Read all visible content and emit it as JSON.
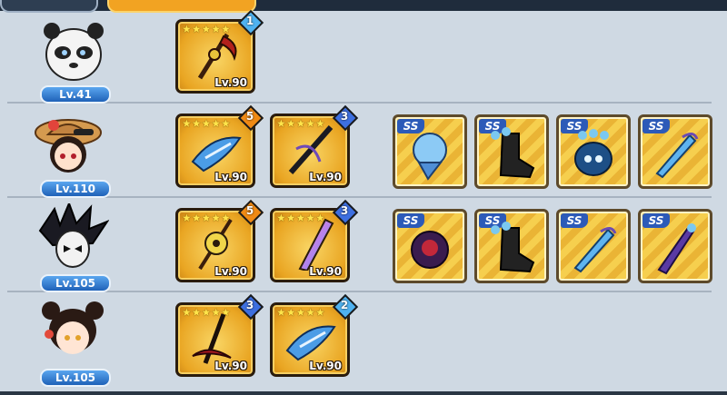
{
  "colors": {
    "accent": "#f2a322",
    "background": "#cfd9e3",
    "badge": "#2f7ad4"
  },
  "tabs": [
    {
      "label": ""
    },
    {
      "label": ""
    }
  ],
  "heroes": [
    {
      "name_icon": "panda-hero-icon",
      "level": "Lv.41",
      "weapons": [
        {
          "icon": "fire-scythe-icon",
          "stars": 5,
          "rank": "1",
          "level": "Lv.90"
        }
      ],
      "equipment": []
    },
    {
      "name_icon": "straw-hat-girl-hero-icon",
      "level": "Lv.110",
      "weapons": [
        {
          "icon": "shark-blade-icon",
          "stars": 5,
          "rank": "5",
          "level": "Lv.90"
        },
        {
          "icon": "dark-katana-icon",
          "stars": 5,
          "rank": "3",
          "level": "Lv.90"
        }
      ],
      "equipment": [
        {
          "tag": "SS",
          "icon": "blue-gauntlet-icon"
        },
        {
          "tag": "SS",
          "icon": "dark-boot-icon"
        },
        {
          "tag": "SS",
          "icon": "blue-spirit-helmet-icon"
        },
        {
          "tag": "SS",
          "icon": "crystal-amulet-icon"
        }
      ]
    },
    {
      "name_icon": "spiky-hair-masked-hero-icon",
      "level": "Lv.105",
      "weapons": [
        {
          "icon": "tomoe-staff-icon",
          "stars": 5,
          "rank": "5",
          "level": "Lv.90"
        },
        {
          "icon": "lightning-blade-icon",
          "stars": 5,
          "rank": "3",
          "level": "Lv.90"
        }
      ],
      "equipment": [
        {
          "tag": "SS",
          "icon": "void-orb-icon"
        },
        {
          "tag": "SS",
          "icon": "dark-boot-icon"
        },
        {
          "tag": "SS",
          "icon": "crystal-amulet-icon"
        },
        {
          "tag": "SS",
          "icon": "purple-dagger-icon"
        }
      ]
    },
    {
      "name_icon": "bun-hair-girl-hero-icon",
      "level": "Lv.105",
      "weapons": [
        {
          "icon": "crimson-scythe-icon",
          "stars": 5,
          "rank": "3",
          "level": "Lv.90"
        },
        {
          "icon": "shark-blade-icon",
          "stars": 5,
          "rank": "2",
          "level": "Lv.90"
        }
      ],
      "equipment": []
    }
  ]
}
